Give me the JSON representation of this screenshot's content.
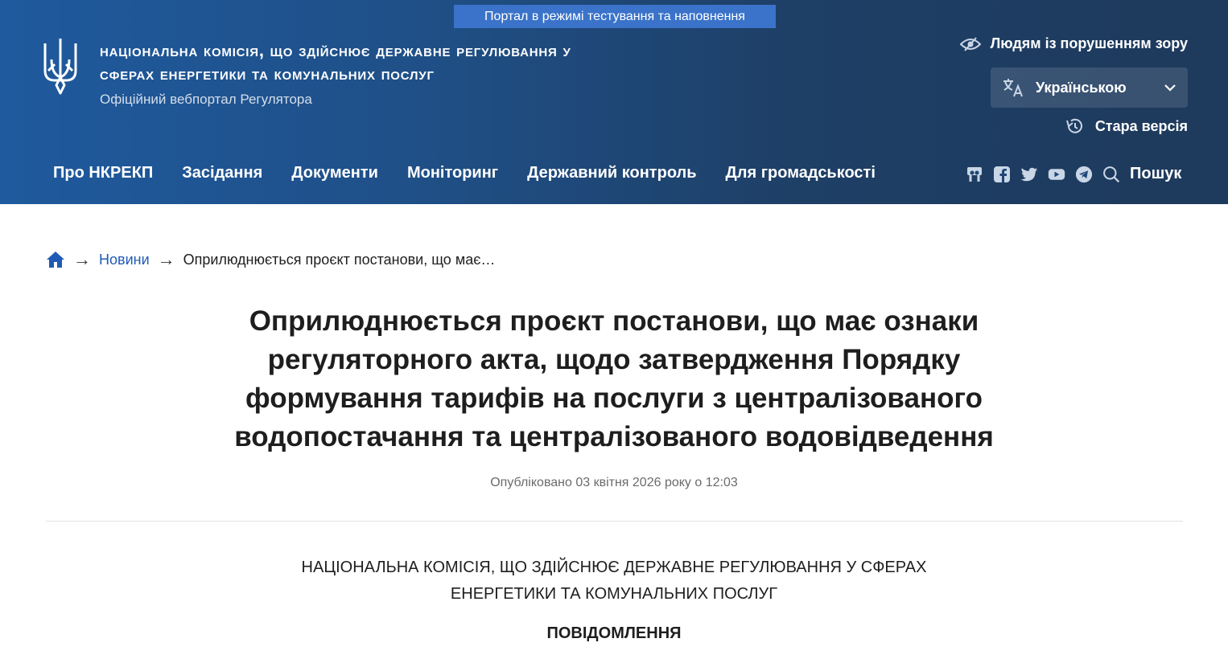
{
  "header": {
    "test_banner": "Портал в режимі тестування та наповнення",
    "title_line1": "Національна комісія, що здійснює державне регулювання у",
    "title_line2": "сферах енергетики та комунальних послуг",
    "subtitle": "Офіційний вебпортал Регулятора",
    "accessibility_label": "Людям із порушенням зору",
    "language_selected": "Українською",
    "old_version_label": "Стара версія"
  },
  "nav": {
    "items": [
      "Про НКРЕКП",
      "Засідання",
      "Документи",
      "Моніторинг",
      "Державний контроль",
      "Для громадськості"
    ],
    "search_label": "Пошук",
    "social_icons": [
      "slideshare-icon",
      "facebook-icon",
      "twitter-icon",
      "youtube-icon",
      "telegram-icon"
    ]
  },
  "breadcrumb": {
    "news": "Новини",
    "current": "Оприлюднюється проєкт постанови, що має…"
  },
  "article": {
    "title_lines": [
      "Оприлюднюється проєкт постанови, що має ознаки",
      "регуляторного акта, щодо затвердження Порядку",
      "формування тарифів на послуги з централізованого",
      "водопостачання та централізованого водовідведення"
    ],
    "published": "Опубліковано 03 квітня 2026 року о 12:03",
    "org_lines": [
      "НАЦІОНАЛЬНА КОМІСІЯ, ЩО ЗДІЙСНЮЄ ДЕРЖАВНЕ РЕГУЛЮВАННЯ У СФЕРАХ",
      "ЕНЕРГЕТИКИ ТА КОМУНАЛЬНИХ ПОСЛУГ"
    ],
    "notice_heading": "ПОВІДОМЛЕННЯ"
  },
  "colors": {
    "header_start": "#1f5a9e",
    "header_end": "#1e3a5c",
    "test_banner": "#3a73c9",
    "link": "#1f5bb5"
  }
}
